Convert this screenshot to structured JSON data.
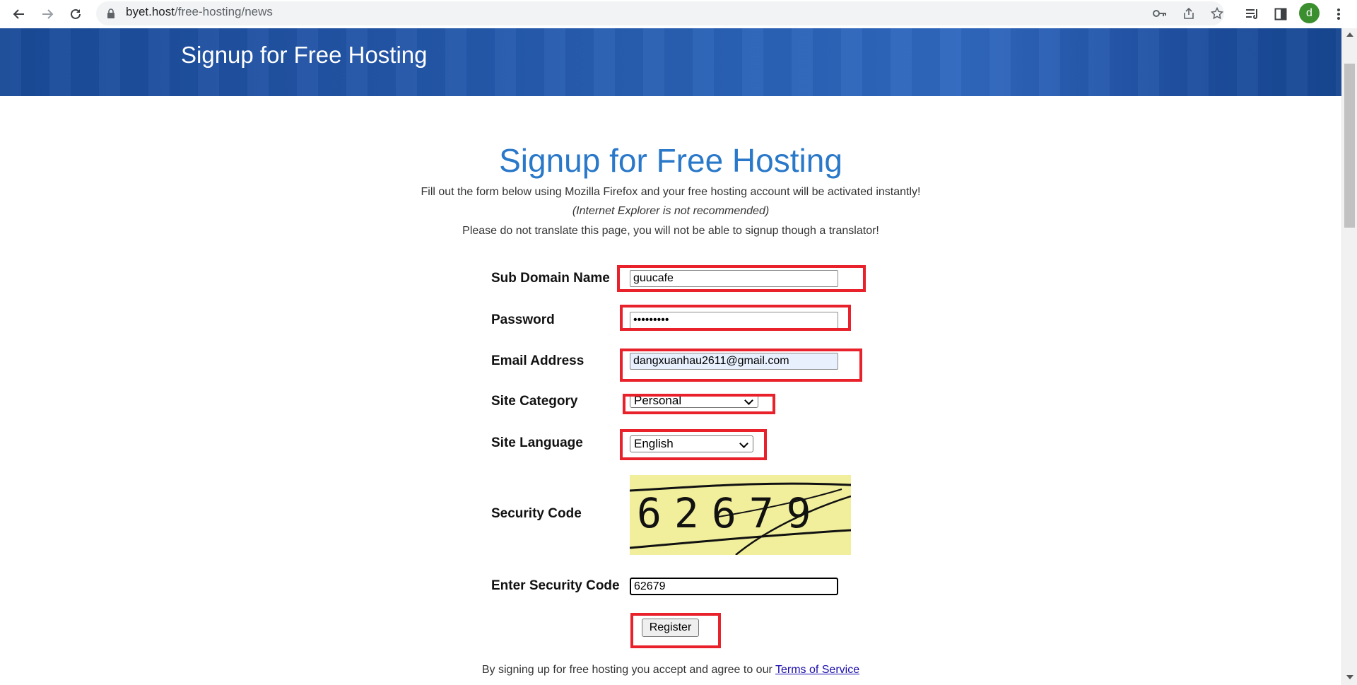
{
  "browser": {
    "url_host": "byet.host",
    "url_path": "/free-hosting/news",
    "profile_initial": "d"
  },
  "banner": {
    "title": "Signup for Free Hosting"
  },
  "page": {
    "heading": "Signup for Free Hosting",
    "intro_line1": "Fill out the form below using Mozilla Firefox and your free hosting account will be activated instantly!",
    "intro_line2": "(Internet Explorer is not recommended)",
    "intro_line3": "Please do not translate this page, you will not be able to signup though a translator!"
  },
  "form": {
    "subdomain": {
      "label": "Sub Domain Name",
      "value": "guucafe"
    },
    "password": {
      "label": "Password",
      "value": "•••••••••"
    },
    "email": {
      "label": "Email Address",
      "value": "dangxuanhau2611@gmail.com"
    },
    "category": {
      "label": "Site Category",
      "value": "Personal"
    },
    "language": {
      "label": "Site Language",
      "value": "English"
    },
    "security": {
      "label": "Security Code",
      "captcha_text": "62679"
    },
    "enter_security": {
      "label": "Enter Security Code",
      "value": "62679"
    },
    "register_label": "Register"
  },
  "footer": {
    "terms_prefix": "By signing up for free hosting you accept and agree to our ",
    "terms_link": "Terms of Service"
  },
  "colors": {
    "heading": "#2a78c9",
    "highlight": "#e8212b",
    "banner": "#2356a8"
  }
}
